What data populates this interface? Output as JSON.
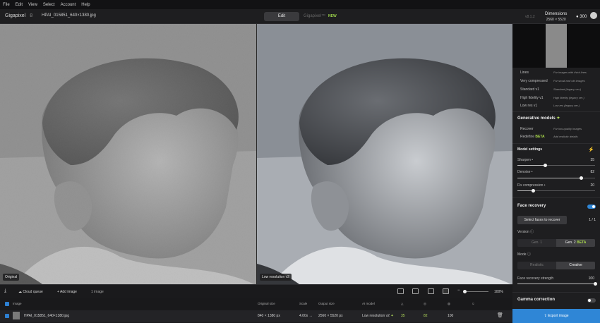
{
  "menu": [
    "File",
    "Edit",
    "View",
    "Select",
    "Account",
    "Help"
  ],
  "header": {
    "app_name": "Gigapixel",
    "app_version": "8",
    "file_name": "HPAI_015851_640×1380.jpg",
    "tab_edit": "Edit",
    "tab_gigapixel": "Gigapixel™",
    "tab_new_badge": "NEW",
    "software_version": "v8.1.2",
    "dimensions_label": "Dimensions",
    "dimensions_value": "2560 × 5520",
    "credits": "300"
  },
  "viewer": {
    "left_label": "Original",
    "right_label": "Low resolution v2"
  },
  "sidebar": {
    "models": [
      {
        "name": "Lines",
        "desc": "For images with thick lines"
      },
      {
        "name": "Very compressed",
        "desc": "For small and old images"
      },
      {
        "name": "Standard v1",
        "desc": "Standard (legacy ver.)"
      },
      {
        "name": "High fidelity v1",
        "desc": "High fidelity (legacy ver.)"
      },
      {
        "name": "Low res v1",
        "desc": "Low res (legacy ver.)"
      }
    ],
    "generative_title": "Generative models",
    "generative": [
      {
        "name": "Recover",
        "desc": "For low-quality images",
        "badge": ""
      },
      {
        "name": "Redefine",
        "desc": "Add realistic details",
        "badge": "BETA"
      }
    ],
    "settings_title": "Model settings",
    "sliders": [
      {
        "label": "Sharpen",
        "value": "35",
        "fraction": 0.35
      },
      {
        "label": "Denoise",
        "value": "82",
        "fraction": 0.82
      },
      {
        "label": "Fix compression",
        "value": "20",
        "fraction": 0.2
      }
    ],
    "face_title": "Face recovery",
    "face_enabled": true,
    "select_faces_btn": "Select faces to recover",
    "faces_count": "1 / 1",
    "version_label": "Version",
    "version_options": [
      {
        "label": "Gen. 1",
        "badge": ""
      },
      {
        "label": "Gen. 2",
        "badge": "BETA"
      }
    ],
    "mode_label": "Mode",
    "mode_options": [
      "Realistic",
      "Creative"
    ],
    "strength_label": "Face recovery strength",
    "strength_value": "100",
    "strength_fraction": 1.0,
    "gamma_title": "Gamma correction",
    "gamma_enabled": false,
    "export_label": "Export image"
  },
  "bottombar": {
    "cloud_queue": "Cloud queue",
    "add_image": "Add image",
    "count": "1 image",
    "zoom": "100%",
    "zoom_fraction": 0.0
  },
  "table": {
    "headers": {
      "image": "Image",
      "orig": "Original size",
      "scale": "Scale",
      "out": "Output size",
      "model": "AI model"
    },
    "row": {
      "name": "HPAI_015851_640×1380.jpg",
      "orig": "840 × 1380 px",
      "scale": "4.00x",
      "out": "2560 × 5520 px",
      "model": "Low resolution v2",
      "sharpen": "35",
      "denoise": "82",
      "fix": "100"
    }
  }
}
